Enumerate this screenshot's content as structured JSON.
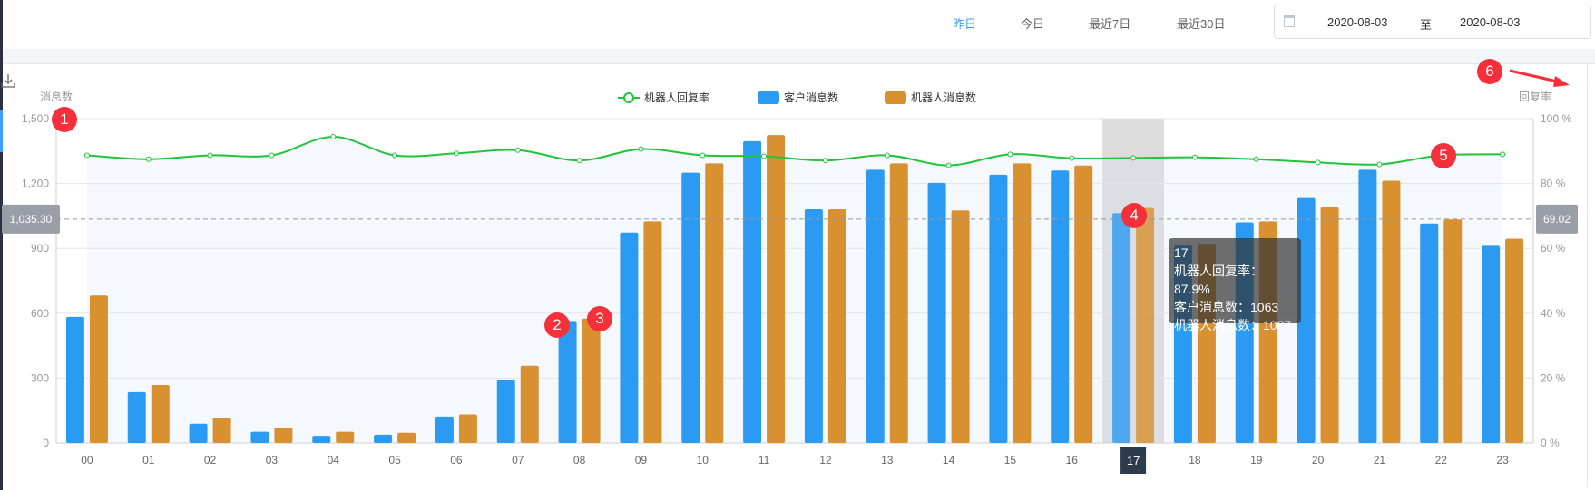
{
  "header": {
    "quick_ranges": [
      {
        "label": "昨日",
        "active": true
      },
      {
        "label": "今日",
        "active": false
      },
      {
        "label": "最近7日",
        "active": false
      },
      {
        "label": "最近30日",
        "active": false
      }
    ],
    "date_range": {
      "start": "2020-08-03",
      "separator": "至",
      "end": "2020-08-03",
      "icon": "calendar-icon"
    }
  },
  "toolbox": {
    "icon": "download-icon"
  },
  "annotations": [
    "1",
    "2",
    "3",
    "4",
    "5",
    "6"
  ],
  "colors": {
    "customer": "#2b9af3",
    "robot": "#d89030",
    "rate": "#22c33a",
    "accent": "#409eff"
  },
  "tooltip": {
    "title": "17",
    "lines": [
      "机器人回复率：87.9%",
      "客户消息数：1063",
      "机器人消息数：1087"
    ]
  },
  "chart_data": {
    "type": "bar",
    "categories": [
      "00",
      "01",
      "02",
      "03",
      "04",
      "05",
      "06",
      "07",
      "08",
      "09",
      "10",
      "11",
      "12",
      "13",
      "14",
      "15",
      "16",
      "17",
      "18",
      "19",
      "20",
      "21",
      "22",
      "23"
    ],
    "ylabel": "消息数",
    "ylabel_right": "回复率",
    "ylim": [
      0,
      1500
    ],
    "yticks": [
      "0",
      "300",
      "600",
      "900",
      "1,200",
      "1,500"
    ],
    "ylim_right": [
      0,
      100
    ],
    "yticks_right": [
      "0 %",
      "20 %",
      "40 %",
      "60 %",
      "80 %",
      "100 %"
    ],
    "grid": true,
    "legend_position": "top-center",
    "highlighted_category": "17",
    "series": [
      {
        "name": "机器人回复率",
        "type": "line",
        "axis": "right",
        "values": [
          88.7,
          87.5,
          88.7,
          88.7,
          94.4,
          88.7,
          89.3,
          90.3,
          87.1,
          90.6,
          88.7,
          88.4,
          87.1,
          88.7,
          85.6,
          89.0,
          87.8,
          87.9,
          88.1,
          87.5,
          86.5,
          85.9,
          88.7,
          89.0
        ]
      },
      {
        "name": "客户消息数",
        "type": "bar",
        "axis": "left",
        "values": [
          583,
          235,
          89,
          52,
          33,
          38,
          122,
          291,
          564,
          973,
          1250,
          1396,
          1081,
          1264,
          1203,
          1241,
          1260,
          1063,
          913,
          1020,
          1133,
          1264,
          1015,
          912
        ]
      },
      {
        "name": "机器人消息数",
        "type": "bar",
        "axis": "left",
        "values": [
          682,
          268,
          117,
          70,
          52,
          47,
          132,
          357,
          575,
          1025,
          1293,
          1424,
          1081,
          1293,
          1076,
          1293,
          1283,
          1087,
          921,
          1025,
          1090,
          1213,
          1034,
          945
        ]
      }
    ],
    "mark_line": {
      "left_label": "1,035.30",
      "right_label": "69.02",
      "value": 1035.3
    }
  }
}
